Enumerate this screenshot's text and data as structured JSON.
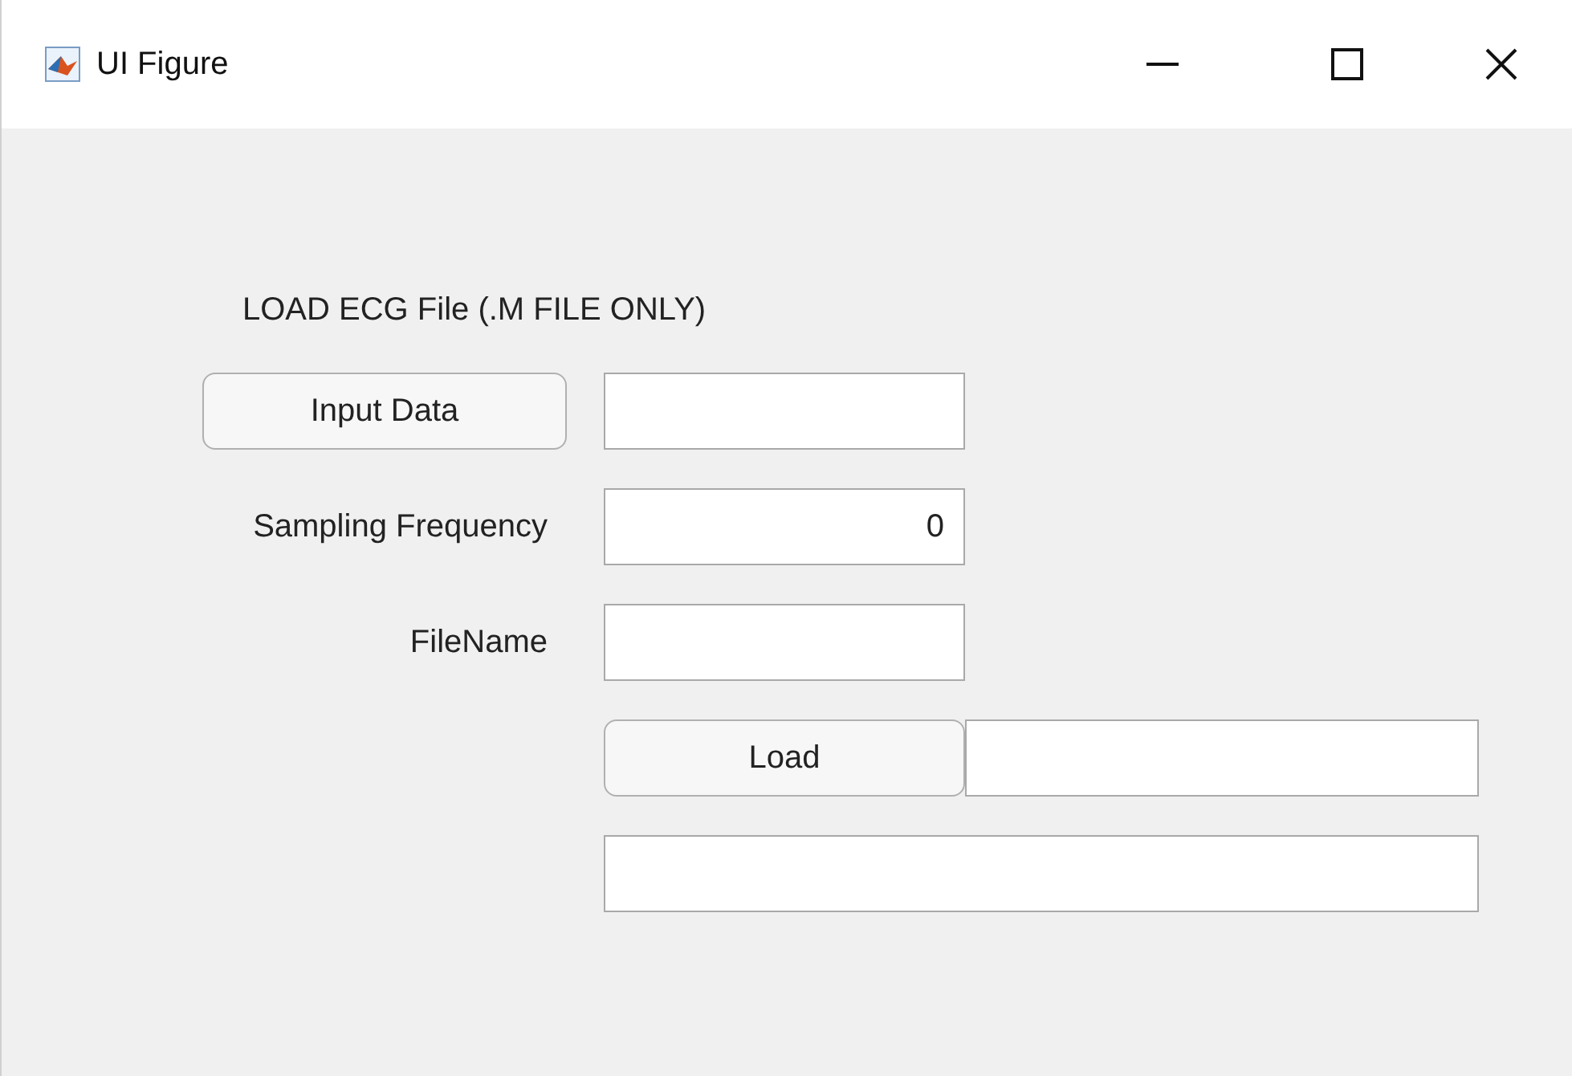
{
  "window": {
    "title": "UI Figure"
  },
  "form": [
    {
      "kind": "heading",
      "text": "LOAD ECG File (.M FILE ONLY)"
    },
    {
      "kind": "button_field",
      "button": "Input Data"
    },
    {
      "kind": "label_field",
      "label": "Sampling Frequency",
      "value": "0"
    },
    {
      "kind": "label_field",
      "label": "FileName"
    },
    {
      "kind": "button_wide_field",
      "button": "Load"
    },
    {
      "kind": "wide_field"
    }
  ]
}
